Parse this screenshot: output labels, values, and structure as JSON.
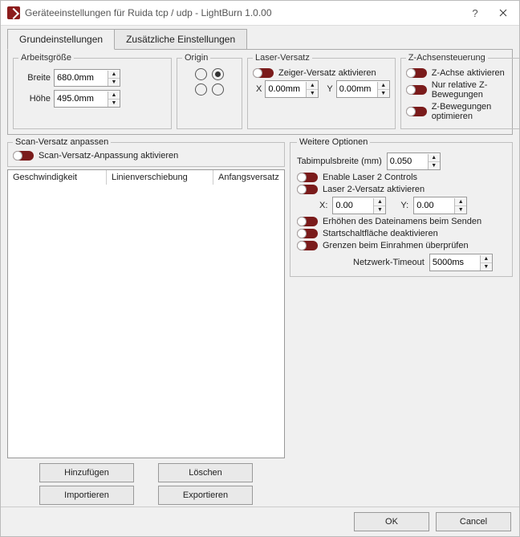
{
  "window": {
    "title": "Geräteeinstellungen für Ruida tcp / udp - LightBurn 1.0.00"
  },
  "tabs": {
    "active": "Grundeinstellungen",
    "inactive": "Zusätzliche Einstellungen"
  },
  "worksize": {
    "legend": "Arbeitsgröße",
    "width_label": "Breite",
    "width_value": "680.0mm",
    "height_label": "Höhe",
    "height_value": "495.0mm"
  },
  "origin": {
    "legend": "Origin",
    "selected_index": 1
  },
  "laser_offset": {
    "legend": "Laser-Versatz",
    "enable_label": "Zeiger-Versatz aktivieren",
    "x_label": "X",
    "x_value": "0.00mm",
    "y_label": "Y",
    "y_value": "0.00mm"
  },
  "z_axis": {
    "legend": "Z-Achsensteuerung",
    "enable": "Z-Achse aktivieren",
    "relative": "Nur relative Z-Bewegungen",
    "optimize": "Z-Bewegungen optimieren"
  },
  "scan": {
    "legend": "Scan-Versatz anpassen",
    "enable": "Scan-Versatz-Anpassung aktivieren",
    "col_speed": "Geschwindigkeit",
    "col_shift": "Linienverschiebung",
    "col_initial": "Anfangsversatz",
    "btn_add": "Hinzufügen",
    "btn_delete": "Löschen",
    "btn_import": "Importieren",
    "btn_export": "Exportieren"
  },
  "more": {
    "legend": "Weitere Optionen",
    "tab_pulse_label": "Tabimpulsbreite (mm)",
    "tab_pulse_value": "0.050",
    "enable_laser2": "Enable Laser 2 Controls",
    "laser2_offset": "Laser 2-Versatz aktivieren",
    "laser2_x_label": "X:",
    "laser2_x_value": "0.00",
    "laser2_y_label": "Y:",
    "laser2_y_value": "0.00",
    "increment_filename": "Erhöhen des Dateinamens beim Senden",
    "disable_start": "Startschaltfläche deaktivieren",
    "check_framing": "Grenzen beim Einrahmen überprüfen",
    "net_timeout_label": "Netzwerk-Timeout",
    "net_timeout_value": "5000ms"
  },
  "footer": {
    "ok": "OK",
    "cancel": "Cancel"
  }
}
